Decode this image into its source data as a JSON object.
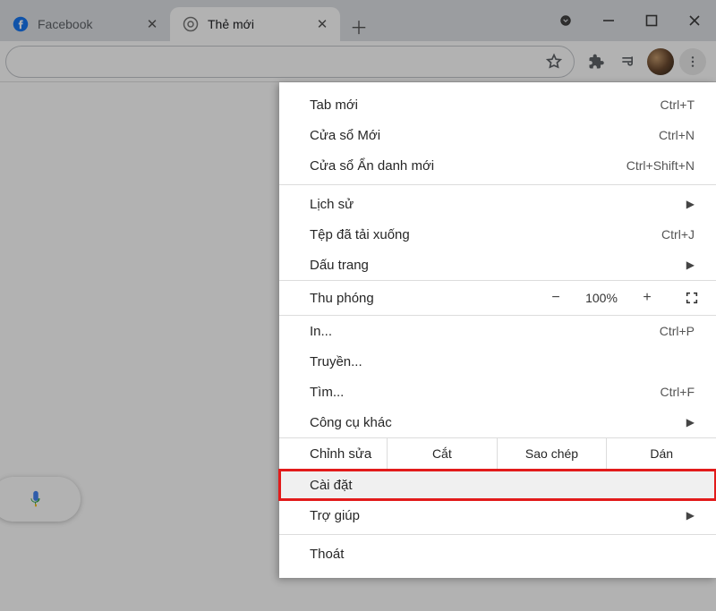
{
  "tabs": [
    {
      "title": "Facebook",
      "active": false
    },
    {
      "title": "Thẻ mới",
      "active": true
    }
  ],
  "menu": {
    "new_tab": {
      "label": "Tab mới",
      "shortcut": "Ctrl+T"
    },
    "new_window": {
      "label": "Cửa sổ Mới",
      "shortcut": "Ctrl+N"
    },
    "incognito": {
      "label": "Cửa sổ Ẩn danh mới",
      "shortcut": "Ctrl+Shift+N"
    },
    "history": {
      "label": "Lịch sử"
    },
    "downloads": {
      "label": "Tệp đã tải xuống",
      "shortcut": "Ctrl+J"
    },
    "bookmarks": {
      "label": "Dấu trang"
    },
    "zoom_label": "Thu phóng",
    "zoom_value": "100%",
    "print": {
      "label": "In...",
      "shortcut": "Ctrl+P"
    },
    "cast": {
      "label": "Truyền..."
    },
    "find": {
      "label": "Tìm...",
      "shortcut": "Ctrl+F"
    },
    "more_tools": {
      "label": "Công cụ khác"
    },
    "edit_label": "Chỉnh sửa",
    "cut": "Cắt",
    "copy": "Sao chép",
    "paste": "Dán",
    "settings": {
      "label": "Cài đặt"
    },
    "help": {
      "label": "Trợ giúp"
    },
    "exit": {
      "label": "Thoát"
    }
  }
}
